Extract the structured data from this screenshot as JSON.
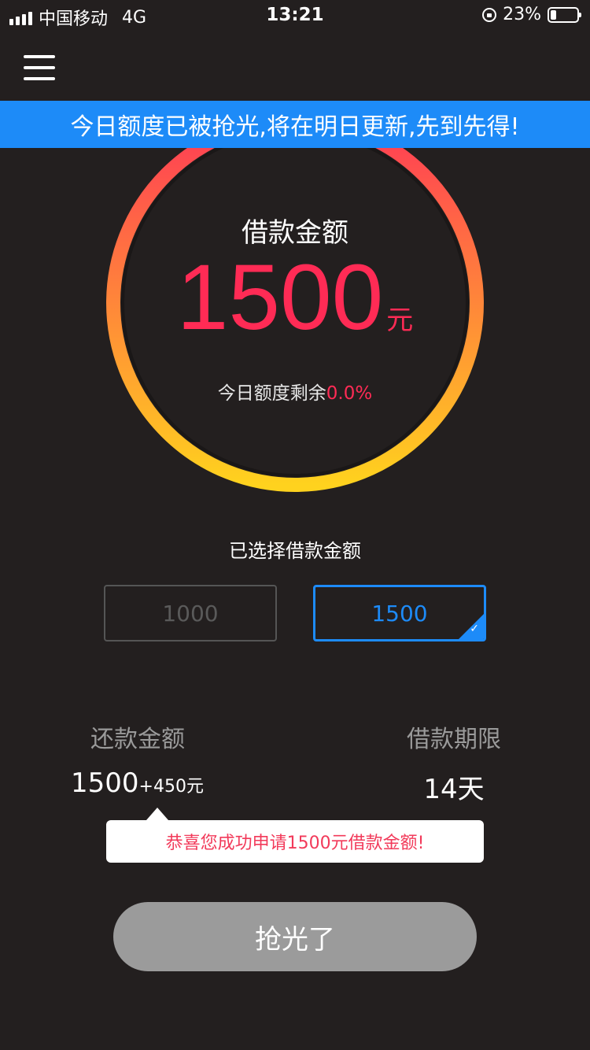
{
  "status_bar": {
    "carrier": "中国移动",
    "network": "4G",
    "time": "13:21",
    "battery": "23%",
    "battery_level": 0.23
  },
  "banner": {
    "text": "今日额度已被抢光,将在明日更新,先到先得!"
  },
  "ring": {
    "title": "借款金额",
    "amount": "1500",
    "unit": "元",
    "remaining_label": "今日额度剩余",
    "remaining_value": "0.0%"
  },
  "selection": {
    "label": "已选择借款金额",
    "options": [
      "1000",
      "1500"
    ],
    "selected": "1500"
  },
  "repay": {
    "label": "还款金额",
    "amount": "1500",
    "interest": "+450元"
  },
  "term": {
    "label": "借款期限",
    "value": "14天"
  },
  "toast": {
    "text": "恭喜您成功申请1500元借款金额!"
  },
  "action": {
    "label": "抢光了"
  },
  "colors": {
    "background": "#231f1f",
    "accent_blue": "#1d8bf8",
    "accent_red": "#ff2b55",
    "ring_start": "#ff3b55",
    "ring_end": "#ffd21e",
    "button_disabled": "#9b9b9b"
  }
}
